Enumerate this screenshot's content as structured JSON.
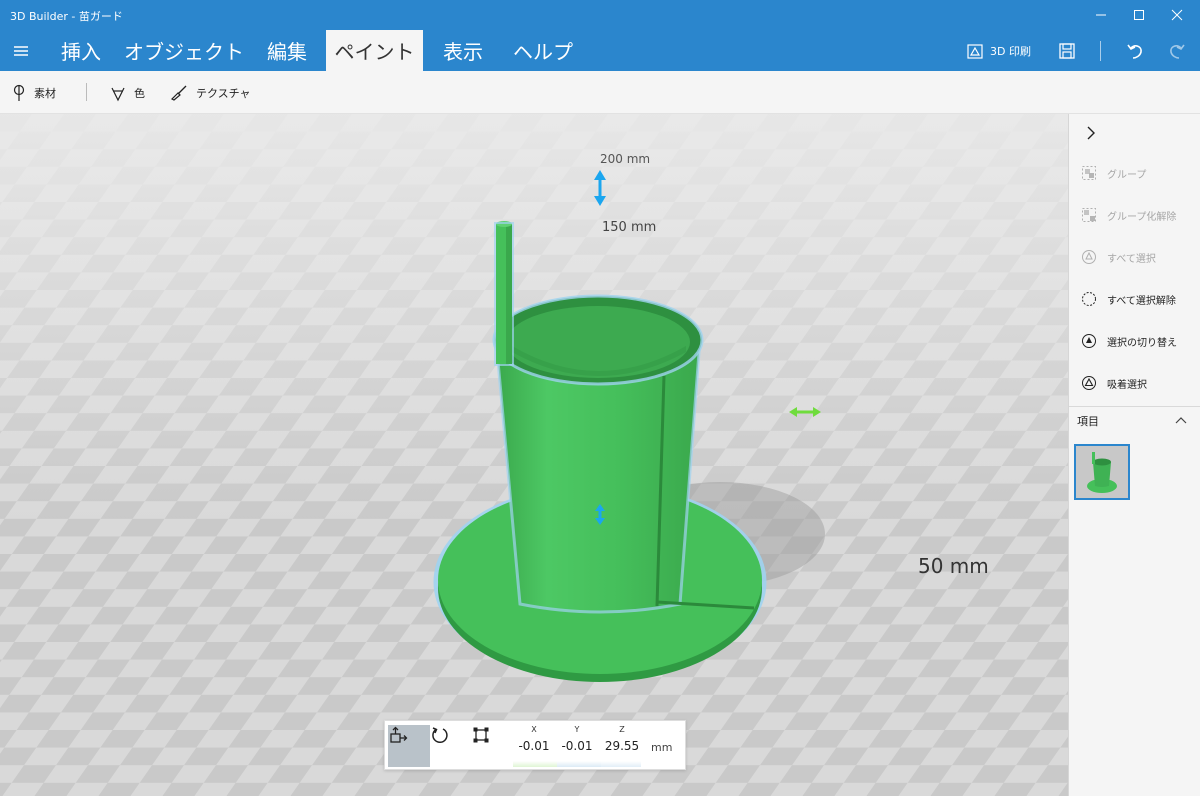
{
  "window": {
    "title": "3D Builder - 苗ガード"
  },
  "menu": {
    "tabs": [
      "挿入",
      "オブジェクト",
      "編集",
      "ペイント",
      "表示",
      "ヘルプ"
    ],
    "active_tab": "ペイント",
    "print_label": "3D 印刷"
  },
  "toolbar": {
    "material_label": "素材",
    "color_label": "色",
    "texture_label": "テクスチャ"
  },
  "viewport": {
    "labels": {
      "mm200": "200 mm",
      "mm150": "150 mm",
      "mm50": "50 mm"
    },
    "object_color": "#45c05a",
    "gizmo_vertical_color": "#1ba6ef",
    "gizmo_horizontal_color": "#6fdc3c"
  },
  "transform": {
    "x_label": "X",
    "y_label": "Y",
    "z_label": "Z",
    "x_value": "-0.01",
    "y_value": "-0.01",
    "z_value": "29.55",
    "unit": "mm"
  },
  "side_panel": {
    "actions": [
      "グループ",
      "グループ化解除",
      "すべて選択",
      "すべて選択解除",
      "選択の切り替え",
      "吸着選択"
    ],
    "items_label": "項目"
  },
  "colors": {
    "titlebar": "#2b86cd",
    "accent": "#2b86cd"
  }
}
